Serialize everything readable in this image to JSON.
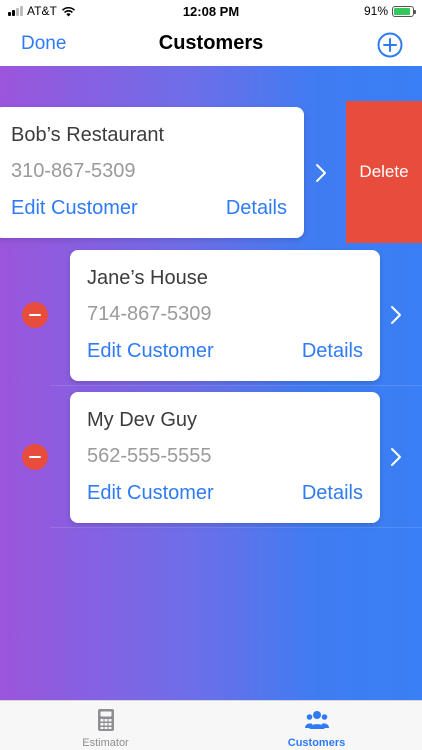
{
  "status_bar": {
    "carrier": "AT&T",
    "time": "12:08 PM",
    "battery": "91%",
    "battery_level": 0.91
  },
  "nav": {
    "done_label": "Done",
    "title": "Customers",
    "add_icon": "plus-circle-icon"
  },
  "customers": [
    {
      "name": "Bob’s Restaurant",
      "phone": "310-867-5309",
      "edit_label": "Edit Customer",
      "details_label": "Details",
      "swiped": true
    },
    {
      "name": "Jane’s House",
      "phone": "714-867-5309",
      "edit_label": "Edit Customer",
      "details_label": "Details",
      "swiped": false
    },
    {
      "name": "My Dev Guy",
      "phone": "562-555-5555",
      "edit_label": "Edit Customer",
      "details_label": "Details",
      "swiped": false
    }
  ],
  "delete_label": "Delete",
  "tabs": [
    {
      "label": "Estimator",
      "icon": "calculator-icon",
      "active": false
    },
    {
      "label": "Customers",
      "icon": "users-icon",
      "active": true
    }
  ],
  "colors": {
    "accent": "#2f7bf5",
    "delete": "#e74c3c",
    "gradient_start": "#9b55dc",
    "gradient_end": "#3a7ff5",
    "tab_inactive": "#8e8e93"
  }
}
